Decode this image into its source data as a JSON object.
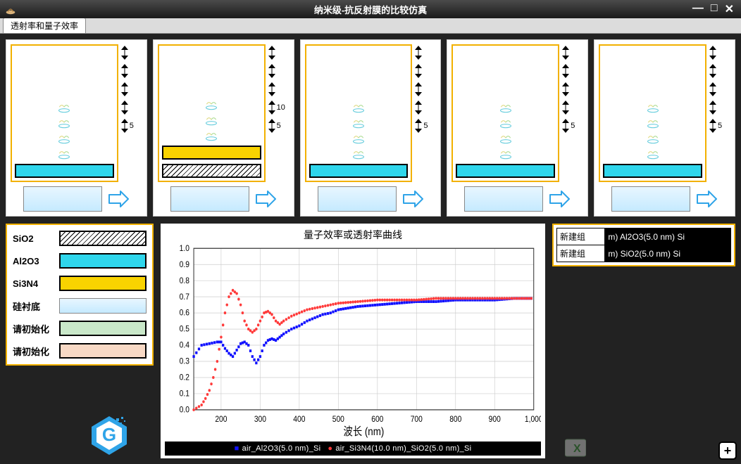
{
  "window": {
    "title": "纳米级-抗反射膜的比较仿真"
  },
  "tab": {
    "label": "透射率和量子效率"
  },
  "panels": [
    {
      "layers": [
        "",
        "",
        "",
        "",
        "al2o3"
      ],
      "layer_vals": [
        "",
        "",
        "",
        "",
        "5"
      ]
    },
    {
      "layers": [
        "",
        "",
        "",
        "si3n4",
        "sio2"
      ],
      "layer_vals": [
        "",
        "",
        "",
        "10",
        "5"
      ]
    },
    {
      "layers": [
        "",
        "",
        "",
        "",
        "al2o3"
      ],
      "layer_vals": [
        "",
        "",
        "",
        "",
        "5"
      ]
    },
    {
      "layers": [
        "",
        "",
        "",
        "",
        "al2o3"
      ],
      "layer_vals": [
        "",
        "",
        "",
        "",
        "5"
      ]
    },
    {
      "layers": [
        "",
        "",
        "",
        "",
        "al2o3"
      ],
      "layer_vals": [
        "",
        "",
        "",
        "",
        "5"
      ]
    }
  ],
  "legend": {
    "rows": [
      {
        "label": "SiO2",
        "cls": "sio2"
      },
      {
        "label": "Al2O3",
        "cls": "al2o3"
      },
      {
        "label": "Si3N4",
        "cls": "si3n4"
      },
      {
        "label": "硅衬底",
        "cls": "substrate"
      },
      {
        "label": "请初始化",
        "cls": "g1"
      },
      {
        "label": "请初始化",
        "cls": "g2"
      }
    ]
  },
  "chart_data": {
    "type": "line",
    "title": "量子效率或透射率曲线",
    "xlabel": "波长 (nm)",
    "ylabel": "",
    "xlim": [
      130,
      1000
    ],
    "ylim": [
      0.0,
      1.0
    ],
    "xticks": [
      200,
      300,
      400,
      500,
      600,
      700,
      800,
      900,
      1000
    ],
    "yticks": [
      0.0,
      0.1,
      0.2,
      0.3,
      0.4,
      0.5,
      0.6,
      0.7,
      0.8,
      0.9,
      1.0
    ],
    "series": [
      {
        "name": "air_Al2O3(5.0 nm)_Si",
        "color": "#1010ff",
        "x": [
          130,
          150,
          170,
          190,
          200,
          210,
          220,
          230,
          240,
          250,
          260,
          270,
          280,
          290,
          300,
          310,
          320,
          330,
          340,
          350,
          360,
          380,
          400,
          420,
          440,
          460,
          480,
          500,
          550,
          600,
          650,
          700,
          750,
          800,
          850,
          900,
          950,
          1000
        ],
        "y": [
          0.33,
          0.4,
          0.41,
          0.42,
          0.42,
          0.38,
          0.35,
          0.33,
          0.37,
          0.41,
          0.42,
          0.4,
          0.33,
          0.29,
          0.33,
          0.4,
          0.43,
          0.44,
          0.43,
          0.45,
          0.47,
          0.5,
          0.52,
          0.55,
          0.57,
          0.59,
          0.6,
          0.62,
          0.64,
          0.65,
          0.66,
          0.67,
          0.67,
          0.68,
          0.68,
          0.68,
          0.69,
          0.69
        ]
      },
      {
        "name": "air_Si3N4(10.0 nm)_SiO2(5.0 nm)_Si",
        "color": "#ff3a3a",
        "x": [
          130,
          150,
          160,
          170,
          180,
          190,
          200,
          210,
          220,
          230,
          240,
          250,
          260,
          270,
          280,
          290,
          300,
          310,
          320,
          330,
          340,
          350,
          360,
          380,
          400,
          420,
          440,
          460,
          480,
          500,
          550,
          600,
          650,
          700,
          750,
          800,
          850,
          900,
          950,
          1000
        ],
        "y": [
          0.0,
          0.03,
          0.07,
          0.12,
          0.2,
          0.3,
          0.45,
          0.6,
          0.7,
          0.74,
          0.72,
          0.65,
          0.55,
          0.5,
          0.48,
          0.5,
          0.55,
          0.6,
          0.61,
          0.59,
          0.55,
          0.53,
          0.55,
          0.58,
          0.6,
          0.62,
          0.63,
          0.64,
          0.65,
          0.66,
          0.67,
          0.68,
          0.68,
          0.68,
          0.69,
          0.69,
          0.69,
          0.69,
          0.69,
          0.69
        ]
      }
    ],
    "legend_bar": [
      {
        "marker": "■",
        "color": "#1010ff",
        "text": "air_Al2O3(5.0 nm)_Si"
      },
      {
        "marker": "●",
        "color": "#ff3a3a",
        "text": "air_Si3N4(10.0 nm)_SiO2(5.0 nm)_Si"
      }
    ]
  },
  "groups": [
    {
      "name": "新建组",
      "desc": "m) Al2O3(5.0 nm) Si"
    },
    {
      "name": "新建组",
      "desc": "m) SiO2(5.0 nm) Si"
    }
  ],
  "icons": {
    "plus": "+"
  }
}
